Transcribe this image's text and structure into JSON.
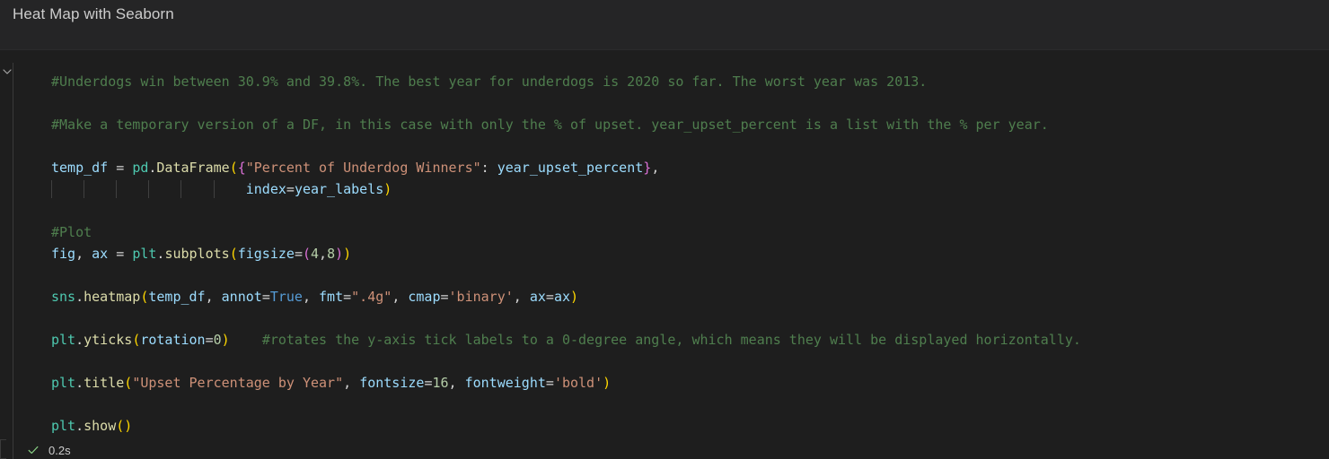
{
  "header": {
    "title": "Heat Map with Seaborn"
  },
  "cell": {
    "collapse_icon": "chevron-down-icon",
    "lines": [
      {
        "id": "comment-underdogs",
        "tokens": [
          {
            "t": "#Underdogs win between 30.9% and 39.8%. The best year for underdogs is 2020 so far. The worst year was 2013.",
            "c": "c-comment"
          }
        ]
      },
      {
        "id": "blank-1",
        "tokens": []
      },
      {
        "id": "comment-make-temp-df",
        "tokens": [
          {
            "t": "#Make a temporary version of a DF, in this case with only the % of upset. year_upset_percent is a list with the % per year.",
            "c": "c-comment"
          }
        ]
      },
      {
        "id": "blank-2",
        "tokens": []
      },
      {
        "id": "code-temp-df",
        "tokens": [
          {
            "t": "temp_df",
            "c": "c-var"
          },
          {
            "t": " = ",
            "c": "c-punct"
          },
          {
            "t": "pd",
            "c": "c-mod"
          },
          {
            "t": ".",
            "c": "c-punct"
          },
          {
            "t": "DataFrame",
            "c": "c-fn"
          },
          {
            "t": "(",
            "c": "b-yellow"
          },
          {
            "t": "{",
            "c": "b-magenta"
          },
          {
            "t": "\"Percent of Underdog Winners\"",
            "c": "c-str"
          },
          {
            "t": ": ",
            "c": "c-punct"
          },
          {
            "t": "year_upset_percent",
            "c": "c-var"
          },
          {
            "t": "}",
            "c": "b-magenta"
          },
          {
            "t": ",",
            "c": "c-punct"
          }
        ]
      },
      {
        "id": "code-index-arg",
        "guides": [
          0,
          4,
          8,
          12,
          16,
          20
        ],
        "tokens": [
          {
            "t": "                        ",
            "c": "c-punct"
          },
          {
            "t": "index",
            "c": "c-var"
          },
          {
            "t": "=",
            "c": "c-punct"
          },
          {
            "t": "year_labels",
            "c": "c-var"
          },
          {
            "t": ")",
            "c": "b-yellow"
          }
        ]
      },
      {
        "id": "blank-3",
        "tokens": []
      },
      {
        "id": "comment-plot",
        "tokens": [
          {
            "t": "#Plot",
            "c": "c-comment"
          }
        ]
      },
      {
        "id": "code-subplots",
        "tokens": [
          {
            "t": "fig",
            "c": "c-var"
          },
          {
            "t": ", ",
            "c": "c-punct"
          },
          {
            "t": "ax",
            "c": "c-var"
          },
          {
            "t": " = ",
            "c": "c-punct"
          },
          {
            "t": "plt",
            "c": "c-mod"
          },
          {
            "t": ".",
            "c": "c-punct"
          },
          {
            "t": "subplots",
            "c": "c-fn"
          },
          {
            "t": "(",
            "c": "b-yellow"
          },
          {
            "t": "figsize",
            "c": "c-var"
          },
          {
            "t": "=",
            "c": "c-punct"
          },
          {
            "t": "(",
            "c": "b-magenta"
          },
          {
            "t": "4",
            "c": "c-num"
          },
          {
            "t": ",",
            "c": "c-punct"
          },
          {
            "t": "8",
            "c": "c-num"
          },
          {
            "t": ")",
            "c": "b-magenta"
          },
          {
            "t": ")",
            "c": "b-yellow"
          }
        ]
      },
      {
        "id": "blank-4",
        "tokens": []
      },
      {
        "id": "code-heatmap",
        "tokens": [
          {
            "t": "sns",
            "c": "c-mod"
          },
          {
            "t": ".",
            "c": "c-punct"
          },
          {
            "t": "heatmap",
            "c": "c-fn"
          },
          {
            "t": "(",
            "c": "b-yellow"
          },
          {
            "t": "temp_df",
            "c": "c-var"
          },
          {
            "t": ", ",
            "c": "c-punct"
          },
          {
            "t": "annot",
            "c": "c-var"
          },
          {
            "t": "=",
            "c": "c-punct"
          },
          {
            "t": "True",
            "c": "c-kw"
          },
          {
            "t": ", ",
            "c": "c-punct"
          },
          {
            "t": "fmt",
            "c": "c-var"
          },
          {
            "t": "=",
            "c": "c-punct"
          },
          {
            "t": "\".4g\"",
            "c": "c-str"
          },
          {
            "t": ", ",
            "c": "c-punct"
          },
          {
            "t": "cmap",
            "c": "c-var"
          },
          {
            "t": "=",
            "c": "c-punct"
          },
          {
            "t": "'binary'",
            "c": "c-str"
          },
          {
            "t": ", ",
            "c": "c-punct"
          },
          {
            "t": "ax",
            "c": "c-var"
          },
          {
            "t": "=",
            "c": "c-punct"
          },
          {
            "t": "ax",
            "c": "c-var"
          },
          {
            "t": ")",
            "c": "b-yellow"
          }
        ]
      },
      {
        "id": "blank-5",
        "tokens": []
      },
      {
        "id": "code-yticks",
        "tokens": [
          {
            "t": "plt",
            "c": "c-mod"
          },
          {
            "t": ".",
            "c": "c-punct"
          },
          {
            "t": "yticks",
            "c": "c-fn"
          },
          {
            "t": "(",
            "c": "b-yellow"
          },
          {
            "t": "rotation",
            "c": "c-var"
          },
          {
            "t": "=",
            "c": "c-punct"
          },
          {
            "t": "0",
            "c": "c-num"
          },
          {
            "t": ")",
            "c": "b-yellow"
          },
          {
            "t": "    ",
            "c": "c-punct"
          },
          {
            "t": "#rotates the y-axis tick labels to a 0-degree angle, which means they will be displayed horizontally.",
            "c": "c-comment"
          }
        ]
      },
      {
        "id": "blank-6",
        "tokens": []
      },
      {
        "id": "code-title",
        "tokens": [
          {
            "t": "plt",
            "c": "c-mod"
          },
          {
            "t": ".",
            "c": "c-punct"
          },
          {
            "t": "title",
            "c": "c-fn"
          },
          {
            "t": "(",
            "c": "b-yellow"
          },
          {
            "t": "\"Upset Percentage by Year\"",
            "c": "c-str"
          },
          {
            "t": ", ",
            "c": "c-punct"
          },
          {
            "t": "fontsize",
            "c": "c-var"
          },
          {
            "t": "=",
            "c": "c-punct"
          },
          {
            "t": "16",
            "c": "c-num"
          },
          {
            "t": ", ",
            "c": "c-punct"
          },
          {
            "t": "fontweight",
            "c": "c-var"
          },
          {
            "t": "=",
            "c": "c-punct"
          },
          {
            "t": "'bold'",
            "c": "c-str"
          },
          {
            "t": ")",
            "c": "b-yellow"
          }
        ]
      },
      {
        "id": "blank-7",
        "tokens": []
      },
      {
        "id": "code-show",
        "tokens": [
          {
            "t": "plt",
            "c": "c-mod"
          },
          {
            "t": ".",
            "c": "c-punct"
          },
          {
            "t": "show",
            "c": "c-fn"
          },
          {
            "t": "(",
            "c": "b-yellow"
          },
          {
            "t": ")",
            "c": "b-yellow"
          }
        ]
      }
    ]
  },
  "execution": {
    "status_icon": "check-icon",
    "elapsed": "0.2s"
  },
  "colors": {
    "background": "#1e1e1e",
    "header_background": "#252526",
    "comment": "#4f7e4e",
    "variable": "#9cdcfe",
    "module": "#4ec9b0",
    "function": "#dcdcaa",
    "string": "#ce9178",
    "number": "#b5cea8",
    "keyword": "#569cd6",
    "success": "#89d185"
  }
}
